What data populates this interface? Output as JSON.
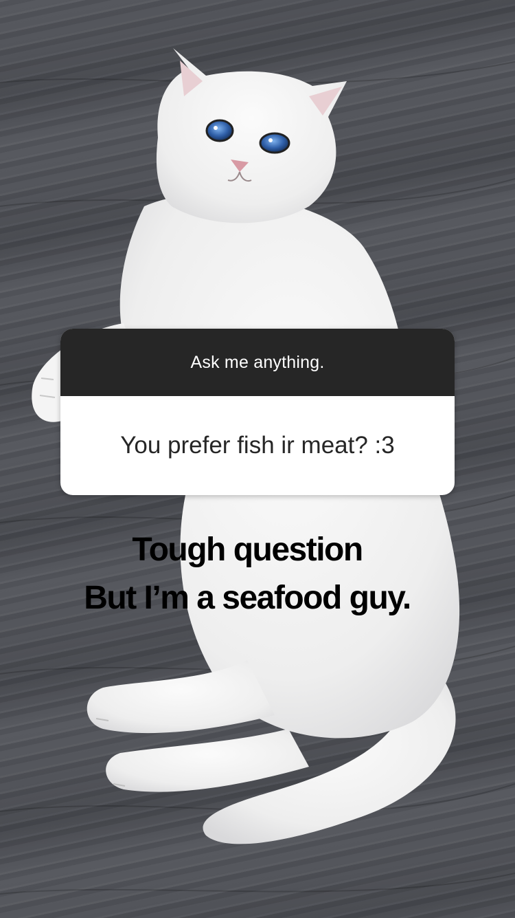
{
  "story": {
    "question_sticker": {
      "prompt": "Ask me anything.",
      "question": "You prefer fish ir meat? :3"
    },
    "answer_text": {
      "line1": "Tough question",
      "line2": "But I’m a seafood guy."
    },
    "background": {
      "subject": "white cat lying on wooden floor",
      "colors": {
        "floor": "#4e5056",
        "cat_fur": "#f2f2f2",
        "cat_eyes": "#3f6fb0",
        "cat_nose": "#d89aa4"
      }
    }
  }
}
